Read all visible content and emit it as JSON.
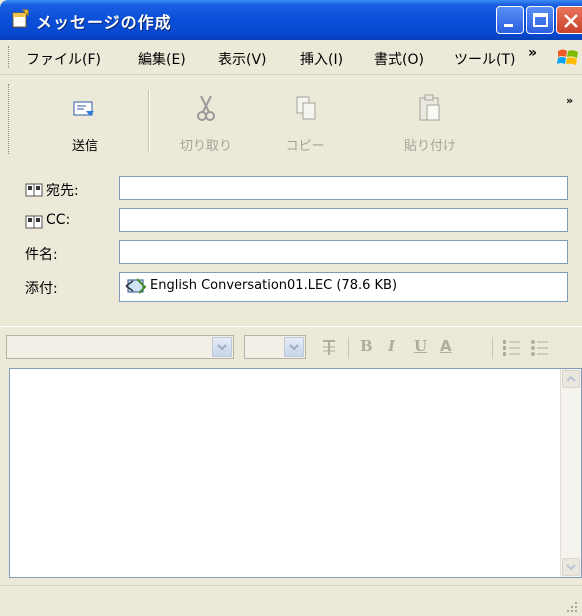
{
  "window": {
    "title": "メッセージの作成"
  },
  "menu": [
    "ファイル(F)",
    "編集(E)",
    "表示(V)",
    "挿入(I)",
    "書式(O)",
    "ツール(T)"
  ],
  "menu_more": "»",
  "toolbar": {
    "send": "送信",
    "cut": "切り取り",
    "copy": "コピー",
    "paste": "貼り付け",
    "more": "»"
  },
  "header": {
    "to_label": "宛先:",
    "cc_label": "CC:",
    "subject_label": "件名:",
    "attach_label": "添付:",
    "to_value": "",
    "cc_value": "",
    "subject_value": "",
    "attachment": "English Conversation01.LEC (78.6 KB)"
  },
  "format": {
    "bold": "B",
    "italic": "I",
    "underline": "U",
    "font_color": "A"
  },
  "body": {
    "text": ""
  },
  "colors": {
    "titlebar": "#0a4fd9",
    "background": "#ece9d8",
    "field_border": "#7f9db9"
  },
  "icons": [
    "new-message-icon",
    "send-icon",
    "scissors-icon",
    "copy-icon",
    "paste-icon",
    "address-book-icon",
    "attachment-icon",
    "paragraph-icon",
    "bullet-list-icon",
    "numbered-list-icon",
    "windows-logo-icon"
  ]
}
